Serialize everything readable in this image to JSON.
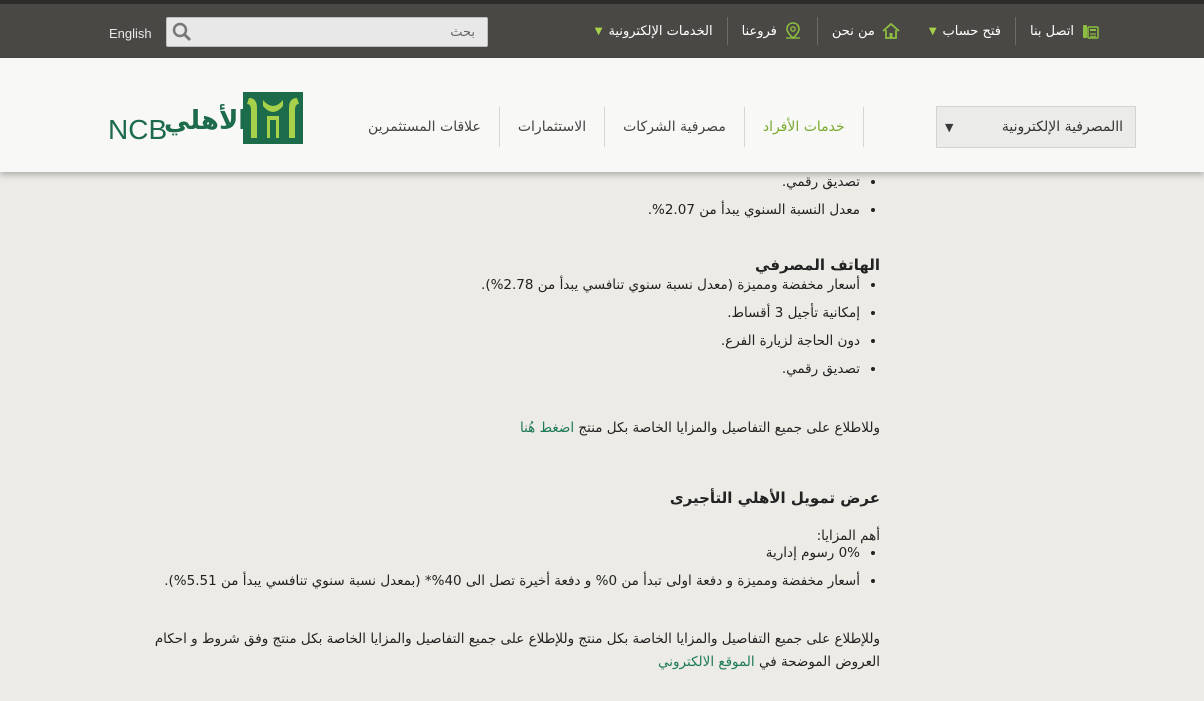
{
  "topbar": {
    "language_link": "English",
    "search_placeholder": "بحث",
    "nav": [
      {
        "label": "الخدمات الإلكترونية",
        "has_dropdown": true
      },
      {
        "label": "فروعنا",
        "icon": "map-pin-icon"
      },
      {
        "label": "من نحن",
        "icon": "home-icon"
      },
      {
        "label": "فتح حساب",
        "has_dropdown": true
      },
      {
        "label": "اتصل بنا",
        "icon": "phone-icon"
      }
    ]
  },
  "mainnav": {
    "ebanking_label": "االمصرفية الإلكترونية",
    "items": [
      {
        "label": "خدمات الأفراد",
        "active": true
      },
      {
        "label": "مصرفية الشركات"
      },
      {
        "label": "الاستثمارات"
      },
      {
        "label": "علاقات المستثمرين"
      }
    ],
    "logo_latin": "NCB",
    "logo_arabic": "الأهلي",
    "brand_color": "#1c6b4a",
    "accent_color": "#a7d14a"
  },
  "content": {
    "section1_bullets": [
      "تصديق رقمي.",
      "معدل النسبة السنوي يبدأ من 2.07%."
    ],
    "phone_banking": {
      "heading": "الهاتف المصرفي",
      "bullets": [
        "أسعار مخفضة ومميزة (معدل نسبة سنوي تنافسي يبدأ من 2.78%).",
        "إمكانية تأجيل 3 أقساط.",
        "دون الحاجة لزيارة الفرع.",
        "تصديق رقمي."
      ]
    },
    "details_text": "وللاطلاع على جميع التفاصيل والمزايا الخاصة بكل منتج ",
    "details_link": "اضغط هُنا",
    "lease_offer": {
      "heading": "عرض تمويل الأهلي التأجيرى",
      "features_label": "أهم المزايا:",
      "bullets": [
        "0% رسوم إدارية",
        "أسعار مخفضة ومميزة و دفعة اولى تبدأ من 0% و دفعة أخيرة تصل الى 40%* (بمعدل نسبة سنوي تنافسي يبدأ من 5.51%)."
      ],
      "footer_text": "وللإطلاع على جميع التفاصيل والمزايا الخاصة بكل منتج وللإطلاع على جميع التفاصيل والمزايا الخاصة بكل منتج وفق شروط و احكام  العروض الموضحة في ",
      "footer_link": "الموقع الالكتروني"
    }
  }
}
